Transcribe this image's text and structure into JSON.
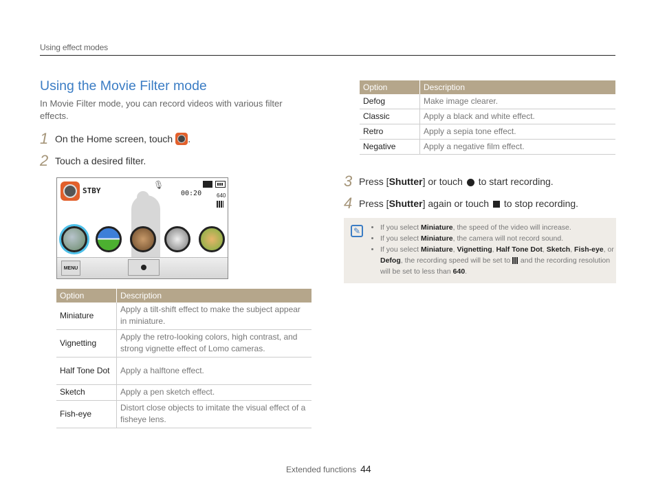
{
  "running_head": "Using effect modes",
  "title": "Using the Movie Filter mode",
  "intro": "In Movie Filter mode, you can record videos with various filter effects.",
  "steps": [
    {
      "num": "1",
      "text": "On the Home screen, touch",
      "after": "."
    },
    {
      "num": "2",
      "text": "Touch a desired filter."
    },
    {
      "num": "3",
      "pre": "Press [",
      "key": "Shutter",
      "mid": "] or touch",
      "post": "to start recording."
    },
    {
      "num": "4",
      "pre": "Press [",
      "key": "Shutter",
      "mid": "] again or touch",
      "post": "to stop recording."
    }
  ],
  "camera_screen": {
    "status": "STBY",
    "time": "00:20",
    "resolution": "640",
    "menu_label": "MENU",
    "filters": [
      "Miniature",
      "Vignetting",
      "Half Tone Dot",
      "Sketch",
      "Fish-eye"
    ]
  },
  "table1": {
    "headers": [
      "Option",
      "Description"
    ],
    "rows": [
      {
        "option": "Miniature",
        "description": "Apply a tilt-shift effect to make the subject appear in miniature."
      },
      {
        "option": "Vignetting",
        "description": "Apply the retro-looking colors, high contrast, and strong vignette effect of Lomo cameras."
      },
      {
        "option": "Half Tone Dot",
        "description": "Apply a halftone effect."
      },
      {
        "option": "Sketch",
        "description": "Apply a pen sketch effect."
      },
      {
        "option": "Fish-eye",
        "description": "Distort close objects to imitate the visual effect of a fisheye lens."
      }
    ]
  },
  "table2": {
    "headers": [
      "Option",
      "Description"
    ],
    "rows": [
      {
        "option": "Defog",
        "description": "Make image clearer."
      },
      {
        "option": "Classic",
        "description": "Apply a black and white effect."
      },
      {
        "option": "Retro",
        "description": "Apply a sepia tone effect."
      },
      {
        "option": "Negative",
        "description": "Apply a negative film effect."
      }
    ]
  },
  "note": {
    "items": [
      {
        "pre": "If you select ",
        "b1": "Miniature",
        "post": ", the speed of the video will increase."
      },
      {
        "pre": "If you select ",
        "b1": "Miniature",
        "post": ", the camera will not record sound."
      },
      {
        "pre": "If you select ",
        "b1": "Miniature",
        "s1": ", ",
        "b2": "Vignetting",
        "s2": ", ",
        "b3": "Half Tone Dot",
        "s3": ", ",
        "b4": "Sketch",
        "s4": ", ",
        "b5": "Fish-eye",
        "s5": ", or ",
        "b6": "Defog",
        "post": ", the recording speed will be set to",
        "post2": " and the recording resolution will be set to less than ",
        "b7": "640",
        "end": "."
      }
    ]
  },
  "footer": {
    "section": "Extended functions",
    "page": "44"
  }
}
